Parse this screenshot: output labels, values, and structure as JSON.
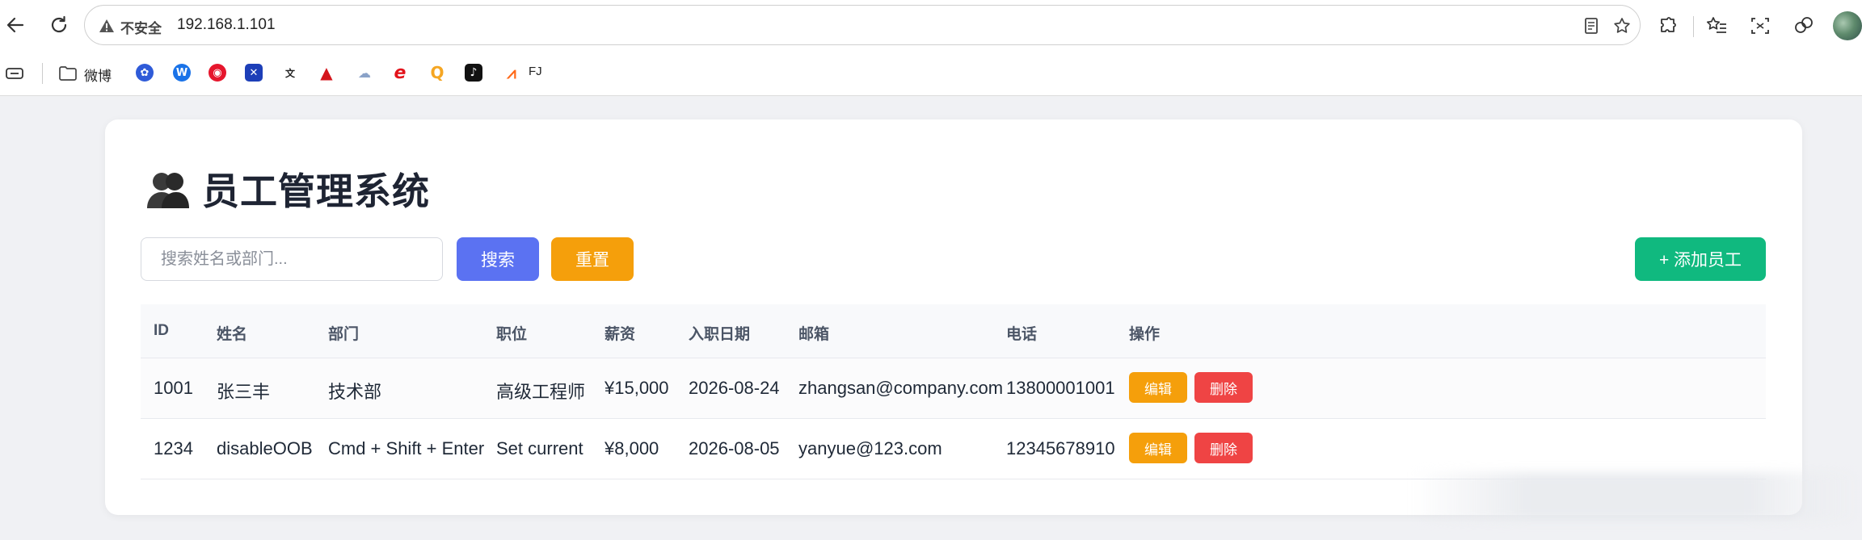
{
  "browser": {
    "security_label": "不安全",
    "url": "192.168.1.101",
    "bookmarks": [
      {
        "name": "folder-weibo",
        "label": "微博"
      },
      {
        "name": "fj",
        "label": "FJ"
      }
    ]
  },
  "page": {
    "title": "员工管理系统",
    "search_placeholder": "搜索姓名或部门...",
    "search_button": "搜索",
    "reset_button": "重置",
    "add_button": "+ 添加员工",
    "columns": [
      "ID",
      "姓名",
      "部门",
      "职位",
      "薪资",
      "入职日期",
      "邮箱",
      "电话",
      "操作"
    ],
    "rows": [
      {
        "id": "1001",
        "name": "张三丰",
        "dept": "技术部",
        "position": "高级工程师",
        "salary": "¥15,000",
        "date": "2026-08-24",
        "email": "zhangsan@company.com",
        "phone": "13800001001",
        "edit": "编辑",
        "delete": "删除"
      },
      {
        "id": "1234",
        "name": "disableOOB",
        "dept": "Cmd + Shift + Enter",
        "position": "Set current",
        "salary": "¥8,000",
        "date": "2026-08-05",
        "email": "yanyue@123.com",
        "phone": "12345678910",
        "edit": "编辑",
        "delete": "删除"
      }
    ]
  },
  "colors": {
    "primary": "#5b72f2",
    "warning": "#f59f0b",
    "success": "#10b97f",
    "danger": "#ef4444"
  }
}
